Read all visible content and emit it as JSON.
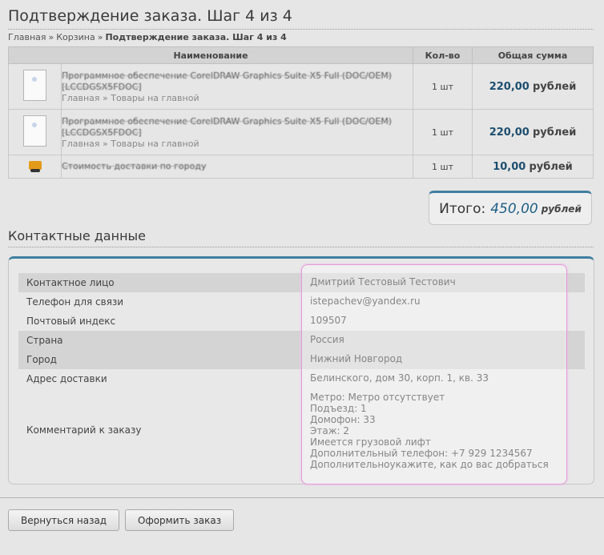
{
  "page": {
    "title": "Подтверждение заказа. Шаг 4 из 4"
  },
  "breadcrumb": {
    "items": [
      "Главная",
      "Корзина"
    ],
    "current": "Подтверждение заказа. Шаг 4 из 4"
  },
  "cart": {
    "headers": [
      "Наименование",
      "Кол-во",
      "Общая сумма"
    ],
    "rows": [
      {
        "name": "Программное обеспечение CorelDRAW Graphics Suite X5 Full (DOC/OEM) [LCCDGSX5FDOC]",
        "category": "Главная » Товары на главной",
        "qty": "1 шт",
        "amount": "220,00",
        "currency": "рублей"
      },
      {
        "name": "Программное обеспечение CorelDRAW Graphics Suite X5 Full (DOC/OEM) [LCCDGSX5FDOC]",
        "category": "Главная » Товары на главной",
        "qty": "1 шт",
        "amount": "220,00",
        "currency": "рублей"
      },
      {
        "name": "Стоимость доставки по городу",
        "category": "",
        "qty": "1 шт",
        "amount": "10,00",
        "currency": "рублей"
      }
    ]
  },
  "total": {
    "label": "Итого:",
    "amount": "450,00",
    "currency": "рублей"
  },
  "contacts": {
    "title": "Контактные данные",
    "rows": [
      {
        "label": "Контактное лицо",
        "value": "Дмитрий Тестовый Тестович"
      },
      {
        "label": "Телефон для связи",
        "value": "istepachev@yandex.ru"
      },
      {
        "label": "Почтовый индекс",
        "value": "109507"
      },
      {
        "label": "Страна",
        "value": "Россия"
      },
      {
        "label": "Город",
        "value": "Нижний Новгород"
      },
      {
        "label": "Адрес доставки",
        "value": "Белинского, дом 30, корп. 1, кв. 33"
      },
      {
        "label": "Комментарий к заказу",
        "value": "Метро: Метро отсутствует\nПодъезд: 1\nДомофон: 33\nЭтаж: 2\nИмеется грузовой лифт\nДополнительный телефон: +7 929 1234567\nДополнительноукажите, как до вас добраться"
      }
    ]
  },
  "buttons": {
    "back": "Вернуться назад",
    "submit": "Оформить заказ"
  },
  "colors": {
    "accent": "#3f7fa0",
    "price": "#1d4e6e",
    "highlight": "#e39ad8"
  },
  "icons": {
    "product": "product-thumbnail-icon",
    "delivery": "truck-icon"
  }
}
